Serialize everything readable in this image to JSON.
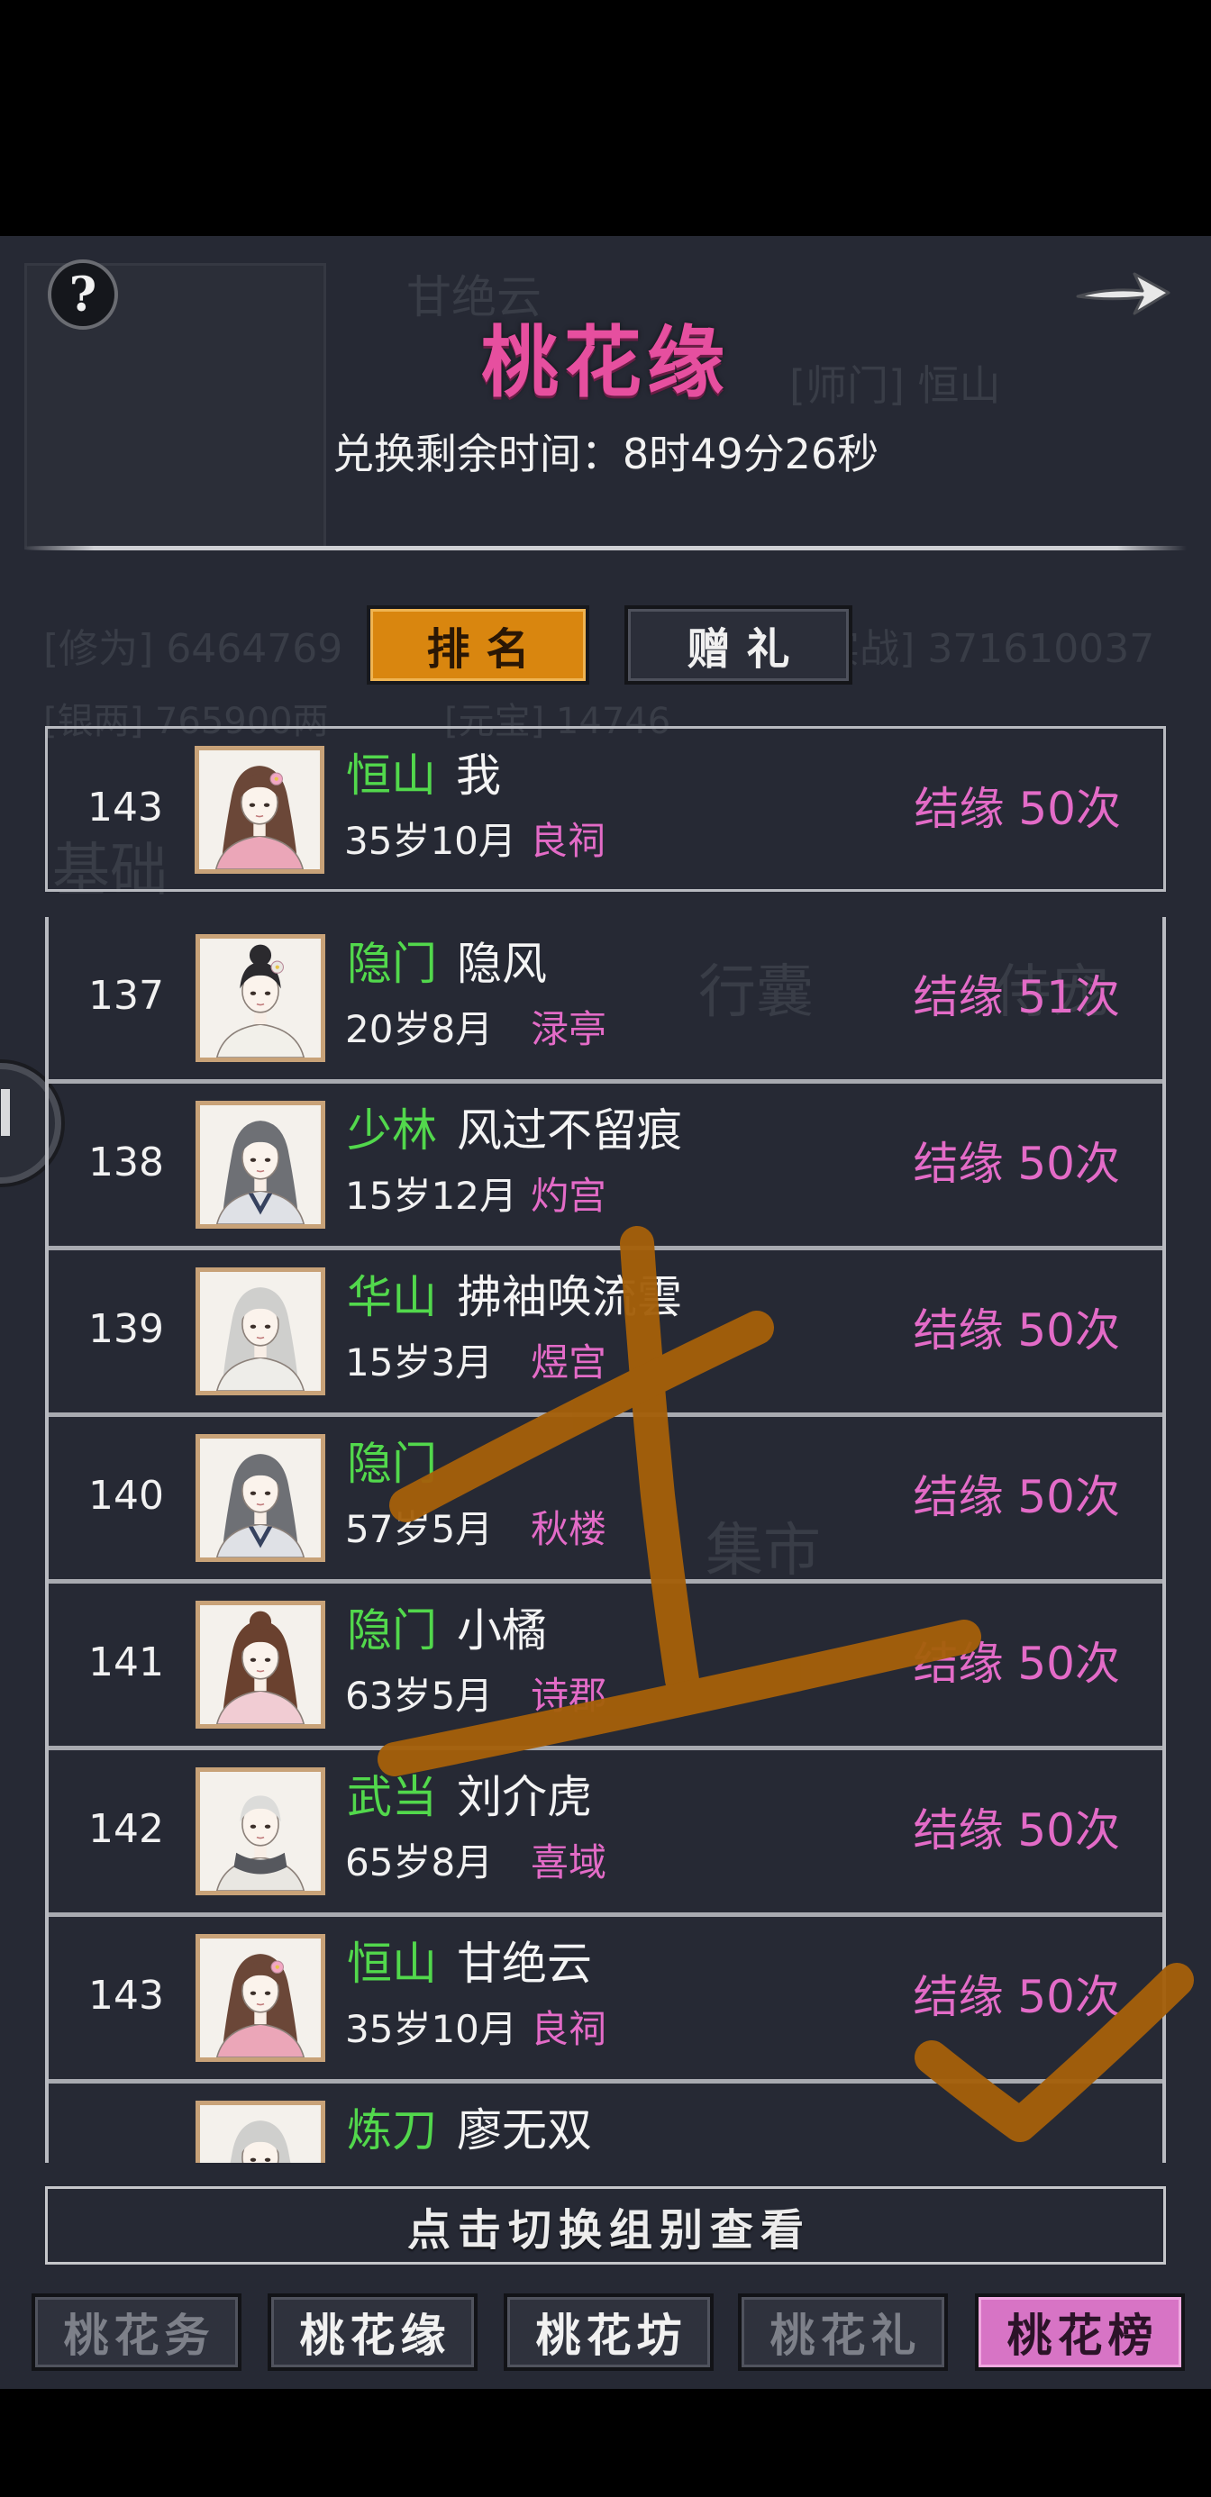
{
  "header": {
    "title": "桃花缘",
    "countdown": "兑换剩余时间：8时49分26秒",
    "help_icon": "question-mark-icon",
    "next_icon": "arrow-right-icon"
  },
  "background_profile": {
    "name": "甘绝云",
    "sect": "[师门] 恒山",
    "cultivation": "[修为] 6464769",
    "combat": "[实战] 371610037",
    "silver": "[银两] 765900两",
    "ingot": "[元宝] 14746",
    "tab_basic": "基础",
    "tab_bag": "行囊",
    "tab_pet": "侍宠",
    "tab_market": "集市"
  },
  "tabs": [
    {
      "label": "排名",
      "active": true
    },
    {
      "label": "赠礼",
      "active": false
    }
  ],
  "self_entry": {
    "rank": "143",
    "sect": "恒山",
    "name": "我",
    "age": "35岁10月",
    "place": "良祠",
    "bond": "结缘 50次",
    "avatar": "portrait-female-pink-robe-icon"
  },
  "ranking": [
    {
      "rank": "137",
      "sect": "隐门",
      "name": "隐风",
      "age": "20岁8月",
      "place": "渌亭",
      "bond": "结缘 51次",
      "avatar": "portrait-female-black-hair-icon"
    },
    {
      "rank": "138",
      "sect": "少林",
      "name": "风过不留痕",
      "age": "15岁12月",
      "place": "灼宫",
      "bond": "结缘 50次",
      "avatar": "portrait-male-gray-hair-profile-icon"
    },
    {
      "rank": "139",
      "sect": "华山",
      "name": "拂袖唤流雲",
      "age": "15岁3月",
      "place": "煜宫",
      "bond": "结缘 50次",
      "avatar": "portrait-male-white-hair-icon"
    },
    {
      "rank": "140",
      "sect": "隐门",
      "name": "",
      "age": "57岁5月",
      "place": "秋楼",
      "bond": "结缘 50次",
      "avatar": "portrait-male-gray-hair-profile-icon"
    },
    {
      "rank": "141",
      "sect": "隐门",
      "name": "小橘",
      "age": "63岁5月",
      "place": "诗郡",
      "bond": "结缘 50次",
      "avatar": "portrait-female-brown-hair-icon"
    },
    {
      "rank": "142",
      "sect": "武当",
      "name": "刘介虎",
      "age": "65岁8月",
      "place": "喜域",
      "bond": "结缘 50次",
      "avatar": "portrait-male-white-hair-scarf-icon"
    },
    {
      "rank": "143",
      "sect": "恒山",
      "name": "甘绝云",
      "age": "35岁10月",
      "place": "良祠",
      "bond": "结缘 50次",
      "avatar": "portrait-female-pink-robe-icon"
    },
    {
      "rank": "",
      "sect": "炼刀",
      "name": "廖无双",
      "age": "",
      "place": "",
      "bond": "",
      "avatar": "portrait-male-white-hair-icon"
    }
  ],
  "switch_group_label": "点击切换组别查看",
  "bottom_nav": [
    {
      "label": "桃花务",
      "active": false
    },
    {
      "label": "桃花缘",
      "active": false
    },
    {
      "label": "桃花坊",
      "active": false
    },
    {
      "label": "桃花礼",
      "active": false
    },
    {
      "label": "桃花榜",
      "active": true
    }
  ],
  "colors": {
    "title_pink": "#e64f9f",
    "sect_green": "#52d84c",
    "accent_pink": "#e36bc7",
    "tab_orange": "#d9860f",
    "nav_active_pink": "#d774c5",
    "marker_brown": "#a4600a"
  }
}
